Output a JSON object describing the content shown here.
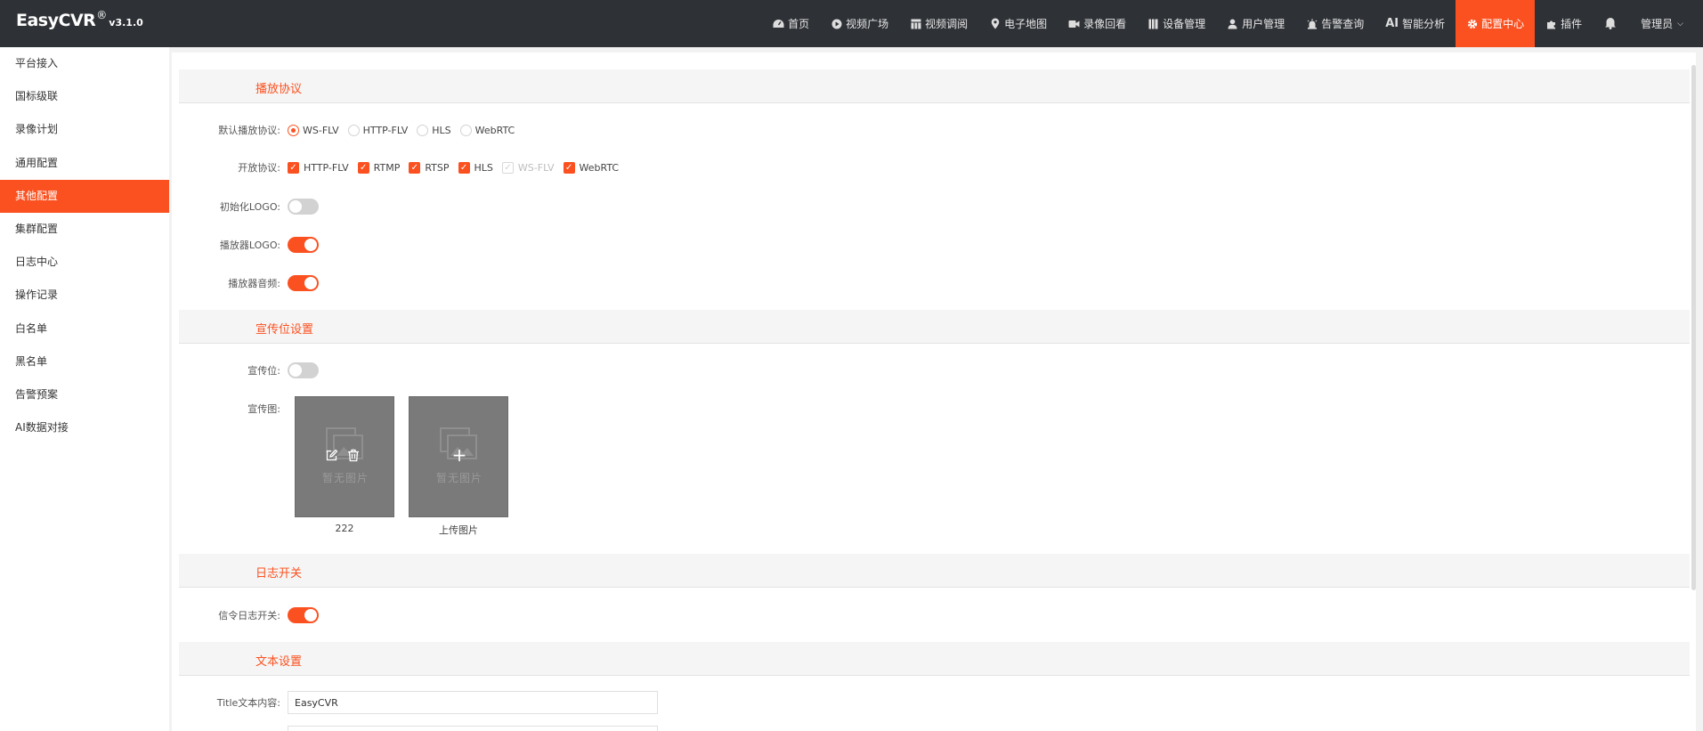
{
  "brand": {
    "name": "EasyCVR",
    "reg": "®",
    "version": "v3.1.0"
  },
  "nav": {
    "items": [
      {
        "label": "首页",
        "icon": "dashboard-icon"
      },
      {
        "label": "视频广场",
        "icon": "play-circle-icon"
      },
      {
        "label": "视频调阅",
        "icon": "grid-icon"
      },
      {
        "label": "电子地图",
        "icon": "map-pin-icon"
      },
      {
        "label": "录像回看",
        "icon": "video-camera-icon"
      },
      {
        "label": "设备管理",
        "icon": "device-icon"
      },
      {
        "label": "用户管理",
        "icon": "user-icon"
      },
      {
        "label": "告警查询",
        "icon": "alarm-icon"
      },
      {
        "label": "智能分析",
        "icon": "ai-icon",
        "prefix": "AI"
      },
      {
        "label": "配置中心",
        "icon": "gear-icon",
        "active": true
      },
      {
        "label": "插件",
        "icon": "puzzle-icon"
      }
    ],
    "user": "管理员"
  },
  "sidebar": {
    "items": [
      "平台接入",
      "国标级联",
      "录像计划",
      "通用配置",
      "其他配置",
      "集群配置",
      "日志中心",
      "操作记录",
      "白名单",
      "黑名单",
      "告警预案",
      "AI数据对接"
    ],
    "active_index": 4
  },
  "sections": {
    "play": {
      "title": "播放协议",
      "default_label": "默认播放协议:",
      "default_options": [
        "WS-FLV",
        "HTTP-FLV",
        "HLS",
        "WebRTC"
      ],
      "default_selected": "WS-FLV",
      "open_label": "开放协议:",
      "open_options": [
        "HTTP-FLV",
        "RTMP",
        "RTSP",
        "HLS",
        "WS-FLV",
        "WebRTC"
      ],
      "open_disabled": "WS-FLV",
      "init_logo_label": "初始化LOGO:",
      "init_logo_on": false,
      "player_logo_label": "播放器LOGO:",
      "player_logo_on": true,
      "player_audio_label": "播放器音频:",
      "player_audio_on": true
    },
    "promo": {
      "title": "宣传位设置",
      "switch_label": "宣传位:",
      "switch_on": false,
      "image_label": "宣传图:",
      "empty_text": "暂无图片",
      "tile1_caption": "222",
      "tile2_caption": "上传图片"
    },
    "log": {
      "title": "日志开关",
      "signal_label": "信令日志开关:",
      "signal_on": true
    },
    "text": {
      "title": "文本设置",
      "title_label": "Title文本内容:",
      "title_value": "EasyCVR"
    }
  },
  "colors": {
    "accent": "#fb5120",
    "topbar": "#2e3136"
  }
}
